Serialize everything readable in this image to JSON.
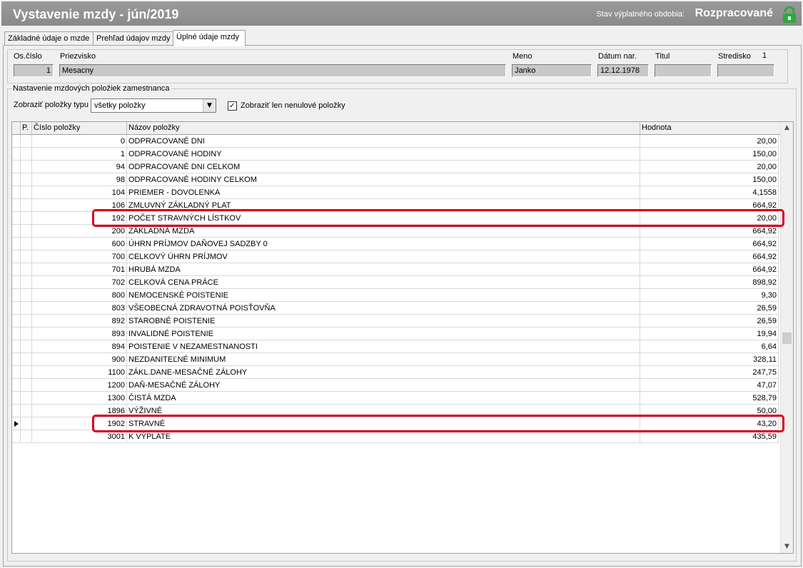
{
  "titlebar": {
    "title": "Vystavenie mzdy -  jún/2019",
    "status_label": "Stav výplatného obdobia:",
    "status_value": "Rozpracované",
    "lock_color": "#2eaa3c"
  },
  "tabs": [
    {
      "label": "Základné údaje o mzde",
      "active": false
    },
    {
      "label": "Prehľad údajov mzdy",
      "active": false
    },
    {
      "label": "Úplné údaje mzdy",
      "active": true
    }
  ],
  "employee": {
    "os_cislo_label": "Os.číslo",
    "os_cislo": "1",
    "priezvisko_label": "Priezvisko",
    "priezvisko": "Mesacny",
    "meno_label": "Meno",
    "meno": "Janko",
    "datum_label": "Dátum nar.",
    "datum": "12.12.1978",
    "titul_label": "Titul",
    "titul": "",
    "stredisko_label": "Stredisko",
    "stredisko": "1",
    "stredisko_field": ""
  },
  "settings": {
    "legend": "Nastavenie mzdových položiek zamestnanca",
    "type_label": "Zobraziť položky typu",
    "type_value": "všetky položky",
    "nonzero_label": "Zobraziť len nenulové položky",
    "nonzero_checked": true
  },
  "grid": {
    "headers": {
      "p": "P.",
      "num": "Číslo položky",
      "name": "Názov položky",
      "value": "Hodnota"
    },
    "rows": [
      {
        "num": "0",
        "name": "ODPRACOVANÉ DNI",
        "value": "20,00"
      },
      {
        "num": "1",
        "name": "ODPRACOVANÉ HODINY",
        "value": "150,00"
      },
      {
        "num": "94",
        "name": "ODPRACOVANÉ DNI CELKOM",
        "value": "20,00"
      },
      {
        "num": "98",
        "name": "ODPRACOVANÉ HODINY CELKOM",
        "value": "150,00"
      },
      {
        "num": "104",
        "name": "PRIEMER - DOVOLENKA",
        "value": "4,1558"
      },
      {
        "num": "106",
        "name": "ZMLUVNÝ ZÁKLADNÝ PLAT",
        "value": "664,92"
      },
      {
        "num": "192",
        "name": "POČET STRAVNÝCH LÍSTKOV",
        "value": "20,00",
        "highlight": true
      },
      {
        "num": "200",
        "name": "ZÁKLADNÁ MZDA",
        "value": "664,92"
      },
      {
        "num": "600",
        "name": "ÚHRN PRÍJMOV DAŇOVEJ SADZBY 0",
        "value": "664,92"
      },
      {
        "num": "700",
        "name": "CELKOVÝ ÚHRN PRÍJMOV",
        "value": "664,92"
      },
      {
        "num": "701",
        "name": "HRUBÁ MZDA",
        "value": "664,92"
      },
      {
        "num": "702",
        "name": "CELKOVÁ CENA PRÁCE",
        "value": "898,92"
      },
      {
        "num": "800",
        "name": "NEMOCENSKÉ POISTENIE",
        "value": "9,30"
      },
      {
        "num": "803",
        "name": "VŠEOBECNÁ ZDRAVOTNÁ POISŤOVŇA",
        "value": "26,59"
      },
      {
        "num": "892",
        "name": "STAROBNÉ POISTENIE",
        "value": "26,59"
      },
      {
        "num": "893",
        "name": "INVALIDNÉ POISTENIE",
        "value": "19,94"
      },
      {
        "num": "894",
        "name": "POISTENIE V NEZAMESTNANOSTI",
        "value": "6,64"
      },
      {
        "num": "900",
        "name": "NEZDANITEĽNÉ MINIMUM",
        "value": "328,11"
      },
      {
        "num": "1100",
        "name": "ZÁKL.DANE-MESAČNÉ ZÁLOHY",
        "value": "247,75"
      },
      {
        "num": "1200",
        "name": "DAŇ-MESAČNÉ ZÁLOHY",
        "value": "47,07"
      },
      {
        "num": "1300",
        "name": "ČISTÁ MZDA",
        "value": "528,79"
      },
      {
        "num": "1896",
        "name": "VÝŽIVNÉ",
        "value": "50,00"
      },
      {
        "num": "1902",
        "name": "STRAVNÉ",
        "value": "43,20",
        "current": true,
        "highlight": true
      },
      {
        "num": "3001",
        "name": "K VÝPLATE",
        "value": "435,59"
      }
    ]
  },
  "highlight_color": "#d8001c"
}
